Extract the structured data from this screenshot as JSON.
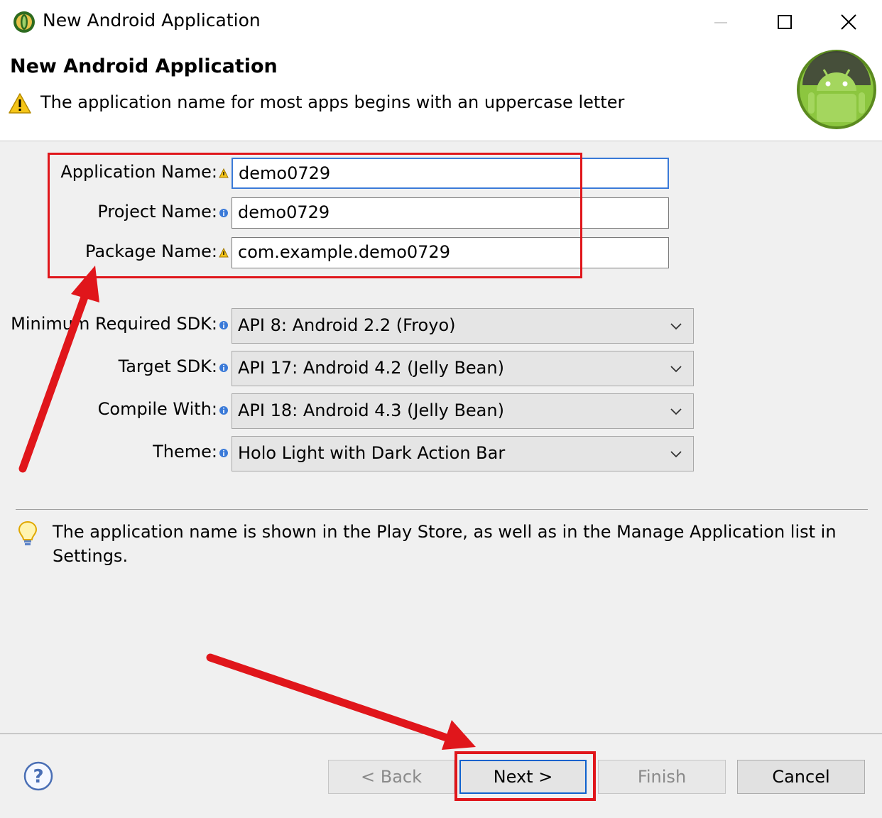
{
  "window": {
    "title": "New Android Application",
    "controls": [
      "minimize-icon",
      "maximize-icon",
      "close-icon"
    ]
  },
  "header": {
    "heading": "New Android Application",
    "message": "The application name for most apps begins with an uppercase letter",
    "message_icon": "warning-icon",
    "logo_icon": "android-logo-icon"
  },
  "form": {
    "application_name": {
      "label": "Application Name:",
      "value": "demo0729",
      "decoration": "warning"
    },
    "project_name": {
      "label": "Project Name:",
      "value": "demo0729",
      "decoration": "info"
    },
    "package_name": {
      "label": "Package Name:",
      "value": "com.example.demo0729",
      "decoration": "warning"
    },
    "min_sdk": {
      "label": "Minimum Required SDK:",
      "value": "API 8: Android 2.2 (Froyo)"
    },
    "target_sdk": {
      "label": "Target SDK:",
      "value": "API 17: Android 4.2 (Jelly Bean)"
    },
    "compile_with": {
      "label": "Compile With:",
      "value": "API 18: Android 4.3 (Jelly Bean)"
    },
    "theme": {
      "label": "Theme:",
      "value": "Holo Light with Dark Action Bar"
    }
  },
  "hint": {
    "icon": "lightbulb-icon",
    "text": "The application name is shown in the Play Store, as well as in the Manage Application list in Settings."
  },
  "buttons": {
    "help_icon": "help-icon",
    "back": "< Back",
    "next": "Next >",
    "finish": "Finish",
    "cancel": "Cancel"
  },
  "colors": {
    "annotation_red": "#e0161b",
    "focus_blue": "#3a7ad8",
    "default_button_border": "#0f62cd",
    "android_green": "#8cc63f"
  }
}
